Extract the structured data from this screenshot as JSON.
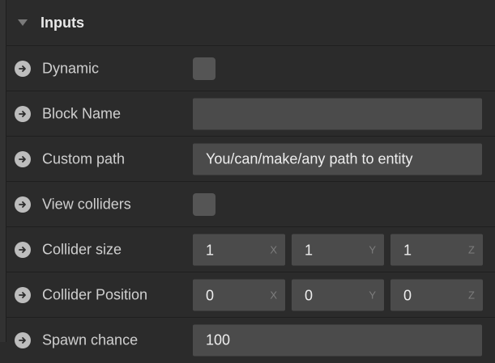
{
  "section": {
    "title": "Inputs"
  },
  "rows": [
    {
      "label": "Dynamic",
      "type": "checkbox",
      "checked": false
    },
    {
      "label": "Block Name",
      "type": "text",
      "value": ""
    },
    {
      "label": "Custom path",
      "type": "text",
      "value": "You/can/make/any path to entity"
    },
    {
      "label": "View colliders",
      "type": "checkbox",
      "checked": false
    },
    {
      "label": "Collider size",
      "type": "vector3",
      "values": [
        "1",
        "1",
        "1"
      ],
      "axes": [
        "X",
        "Y",
        "Z"
      ]
    },
    {
      "label": "Collider Position",
      "type": "vector3",
      "values": [
        "0",
        "0",
        "0"
      ],
      "axes": [
        "X",
        "Y",
        "Z"
      ]
    },
    {
      "label": "Spawn chance",
      "type": "text",
      "value": "100"
    }
  ],
  "icons": {
    "row_arrow": "arrow-right-circle-icon",
    "collapse": "triangle-down-icon"
  },
  "colors": {
    "background": "#2b2b2b",
    "field": "#4b4b4b",
    "checkbox": "#555555"
  }
}
